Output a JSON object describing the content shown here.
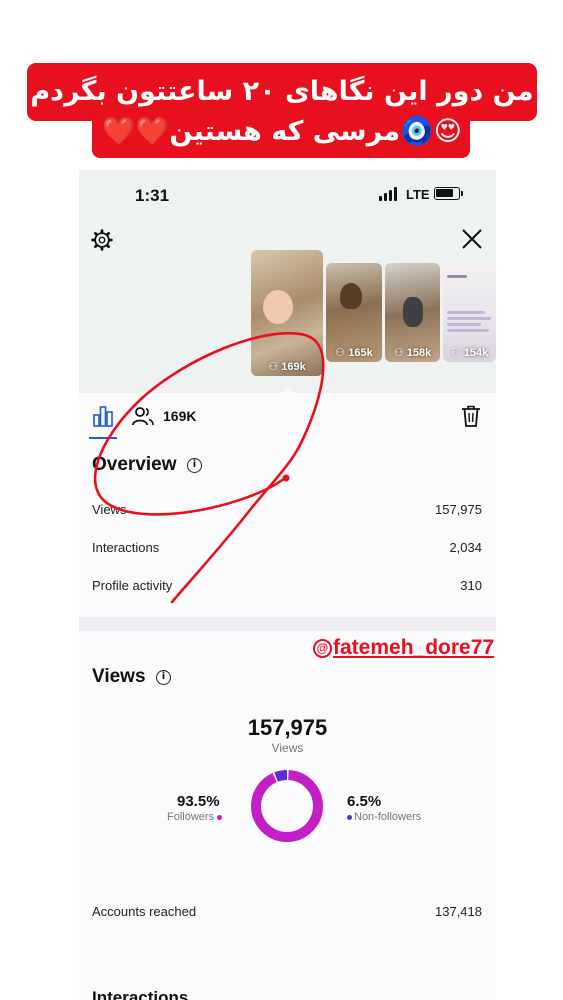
{
  "caption": {
    "line1": "من دور این نگاهای ۲۰ ساعتتون بگردم",
    "line2": "😍🧿مرسی که هستین❤️❤️"
  },
  "status_bar": {
    "time": "1:31",
    "network": "LTE"
  },
  "thumbnails": [
    {
      "count": "169k",
      "selected": true
    },
    {
      "count": "165k"
    },
    {
      "count": "158k"
    },
    {
      "count": "154k"
    }
  ],
  "tabs": {
    "reach_count": "169K"
  },
  "overview": {
    "title": "Overview",
    "rows": [
      {
        "label": "Views",
        "value": "157,975"
      },
      {
        "label": "Interactions",
        "value": "2,034"
      },
      {
        "label": "Profile activity",
        "value": "310"
      }
    ]
  },
  "views": {
    "title": "Views",
    "total": "157,975",
    "total_label": "Views",
    "followers_pct": "93.5%",
    "followers_label": "Followers",
    "nonfollowers_pct": "6.5%",
    "nonfollowers_label": "Non-followers",
    "accounts_reached_label": "Accounts reached",
    "accounts_reached_value": "137,418",
    "next_section_title": "Interactions"
  },
  "chart_data": {
    "type": "pie",
    "categories": [
      "Followers",
      "Non-followers"
    ],
    "values": [
      93.5,
      6.5
    ],
    "colors": [
      "#c21fc7",
      "#5b2bd6"
    ]
  },
  "watermark": {
    "handle": "fatemeh_dore77"
  },
  "colors": {
    "caption_bg": "#e8101e",
    "accent_blue": "#1f5bd6",
    "followers": "#c21fc7",
    "non_followers": "#5b2bd6",
    "annotation_red": "#e8101e"
  }
}
